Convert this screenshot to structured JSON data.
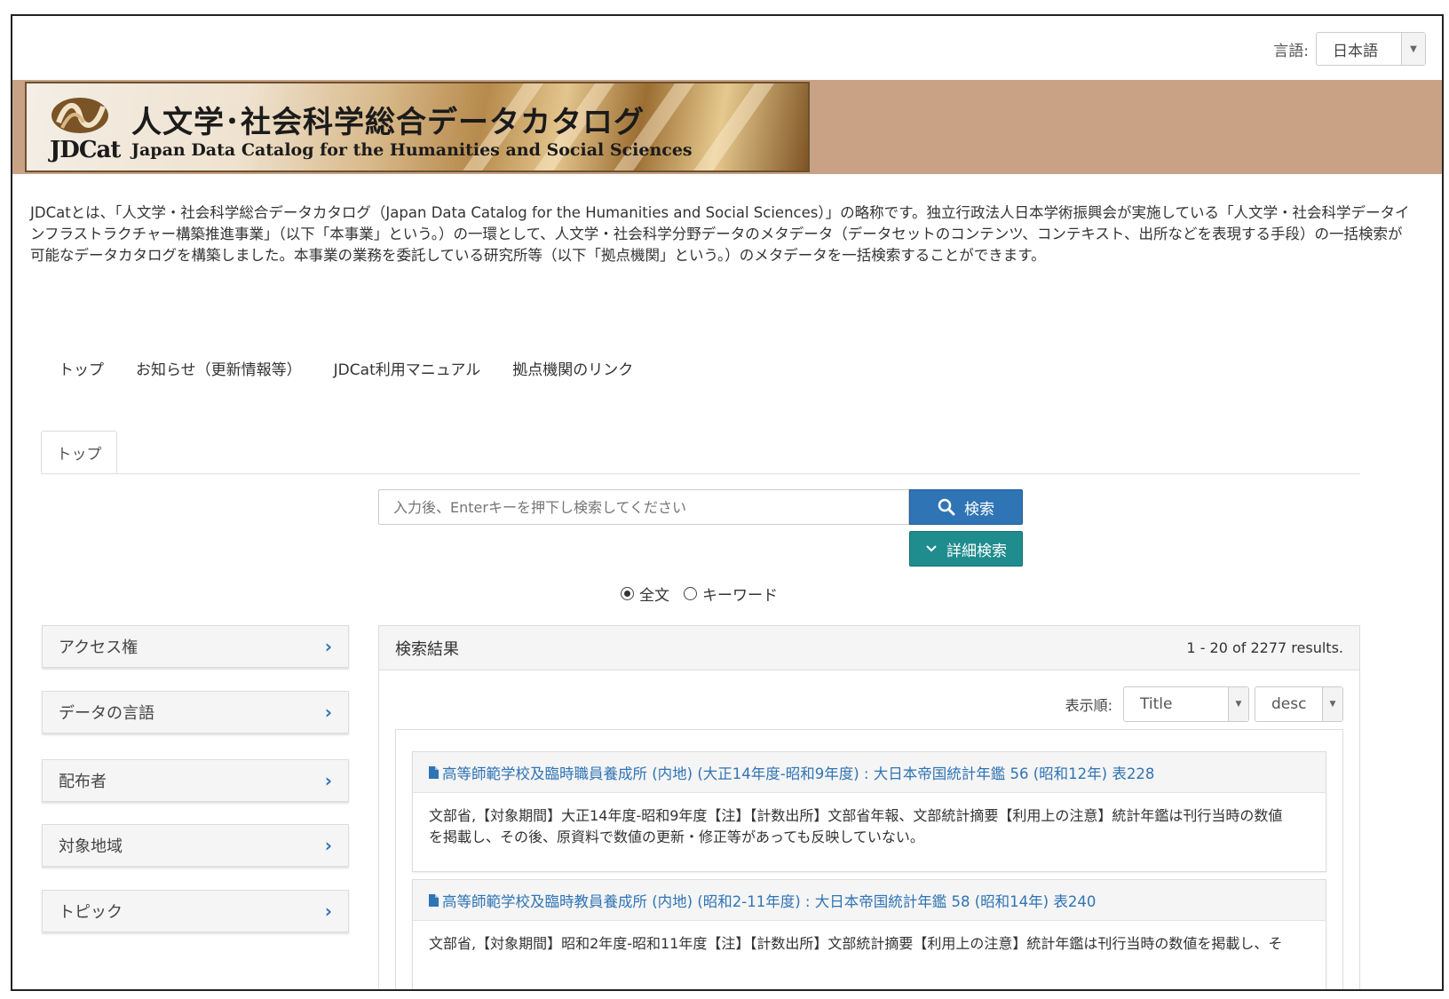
{
  "language": {
    "label": "言語:",
    "selected": "日本語"
  },
  "banner": {
    "logo_text": "JDCat",
    "title": "人文学･社会科学総合データカタログ",
    "subtitle": "Japan Data Catalog for the Humanities and Social Sciences",
    "background_color": "#c9a184"
  },
  "description": "JDCatとは、「人文学・社会科学総合データカタログ（Japan Data Catalog for the Humanities and Social Sciences）」の略称です。独立行政法人日本学術振興会が実施している「人文学・社会科学データインフラストラクチャー構築推進事業」（以下「本事業」という。）の一環として、人文学・社会科学分野データのメタデータ（データセットのコンテンツ、コンテキスト、出所などを表現する手段）の一括検索が可能なデータカタログを構築しました。本事業の業務を委託している研究所等（以下「拠点機関」という。）のメタデータを一括検索することができます。",
  "nav": [
    {
      "label": "トップ"
    },
    {
      "label": "お知らせ（更新情報等）"
    },
    {
      "label": "JDCat利用マニュアル"
    },
    {
      "label": "拠点機関のリンク"
    }
  ],
  "tabs": [
    {
      "label": "トップ",
      "active": true
    }
  ],
  "search": {
    "placeholder": "入力後、Enterキーを押下し検索してください",
    "value": "",
    "search_button": "検索",
    "advanced_button": "詳細検索",
    "modes": [
      {
        "label": "全文",
        "selected": true
      },
      {
        "label": "キーワード",
        "selected": false
      }
    ],
    "search_color": "#2f74b5",
    "advanced_color": "#1f8c8e"
  },
  "facets": [
    {
      "label": "アクセス権"
    },
    {
      "label": "データの言語"
    },
    {
      "label": "配布者"
    },
    {
      "label": "対象地域"
    },
    {
      "label": "トピック"
    }
  ],
  "results": {
    "title": "検索結果",
    "count_text": "1 - 20 of 2277 results.",
    "sort_label": "表示順:",
    "sort_field": "Title",
    "sort_order": "desc",
    "items": [
      {
        "title": "高等師範学校及臨時職員養成所 (内地) (大正14年度-昭和9年度) : 大日本帝国統計年鑑 56 (昭和12年) 表228",
        "snippet_line1": "文部省,【対象期間】大正14年度-昭和9年度【注】【計数出所】文部省年報、文部統計摘要【利用上の注意】統計年鑑は刊行当時の数値",
        "snippet_line2": "を掲載し、その後、原資料で数値の更新・修正等があっても反映していない。"
      },
      {
        "title": "高等師範学校及臨時教員養成所 (内地) (昭和2-11年度) : 大日本帝国統計年鑑 58 (昭和14年) 表240",
        "snippet_line1": "文部省,【対象期間】昭和2年度-昭和11年度【注】【計数出所】文部統計摘要【利用上の注意】統計年鑑は刊行当時の数値を掲載し、そ",
        "snippet_line2": ""
      }
    ]
  }
}
